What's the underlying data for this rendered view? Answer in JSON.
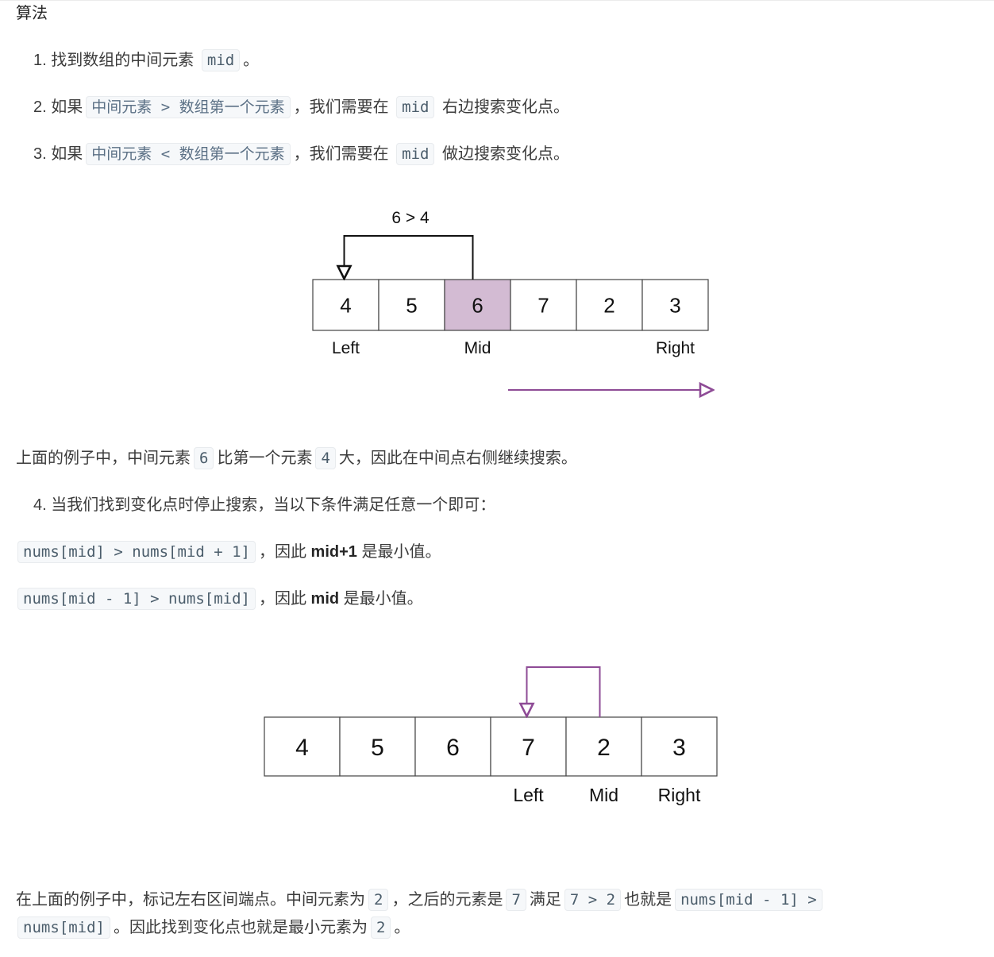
{
  "heading": "算法",
  "steps": [
    {
      "num": "1.",
      "text": "找到数组的中间元素",
      "code": "mid",
      "tail": "。"
    },
    {
      "num": "2.",
      "pre": "如果",
      "code1": "中间元素 > 数组第一个元素",
      "mid": "，我们需要在",
      "code2": "mid",
      "tail": "右边搜索变化点。"
    },
    {
      "num": "3.",
      "pre": "如果",
      "code1": "中间元素 < 数组第一个元素",
      "mid": "，我们需要在",
      "code2": "mid",
      "tail": "做边搜索变化点。"
    }
  ],
  "diagram1": {
    "comparison_label": "6 > 4",
    "cells": [
      "4",
      "5",
      "6",
      "7",
      "2",
      "3"
    ],
    "highlight_index": 2,
    "highlight_color": "#d3bbd3",
    "pointer_labels": [
      {
        "index": 0,
        "label": "Left"
      },
      {
        "index": 2,
        "label": "Mid"
      },
      {
        "index": 5,
        "label": "Right"
      }
    ],
    "arrow_from_index": 2,
    "arrow_to_index": 0,
    "arrow_color": "#111111",
    "direction_arrow_color": "#8e4b96",
    "direction": "right"
  },
  "para1": {
    "a": "上面的例子中，中间元素",
    "code1": "6",
    "b": "比第一个元素",
    "code2": "4",
    "c": "大，因此在中间点右侧继续搜索。"
  },
  "step4": {
    "num": "4.",
    "text": "当我们找到变化点时停止搜索，当以下条件满足任意一个即可："
  },
  "conditions": [
    {
      "code": "nums[mid] > nums[mid + 1]",
      "a": "，因此",
      "bold": "mid+1",
      "b": "是最小值。"
    },
    {
      "code": "nums[mid - 1] > nums[mid]",
      "a": "，因此",
      "bold": "mid",
      "b": "是最小值。"
    }
  ],
  "diagram2": {
    "cells": [
      "4",
      "5",
      "6",
      "7",
      "2",
      "3"
    ],
    "pointer_labels": [
      {
        "index": 3,
        "label": "Left"
      },
      {
        "index": 4,
        "label": "Mid"
      },
      {
        "index": 5,
        "label": "Right"
      }
    ],
    "arrow_from_index": 4,
    "arrow_to_index": 3,
    "arrow_color": "#8e4b96"
  },
  "para2": {
    "a": "在上面的例子中，标记左右区间端点。中间元素为",
    "code1": "2",
    "b": "，之后的元素是",
    "code2": "7",
    "c": "满足",
    "code3": "7 > 2",
    "d": "也就是",
    "code4": "nums[mid - 1] >",
    "code5": "nums[mid]",
    "e": "。因此找到变化点也就是最小元素为",
    "code6": "2",
    "f": "。"
  }
}
